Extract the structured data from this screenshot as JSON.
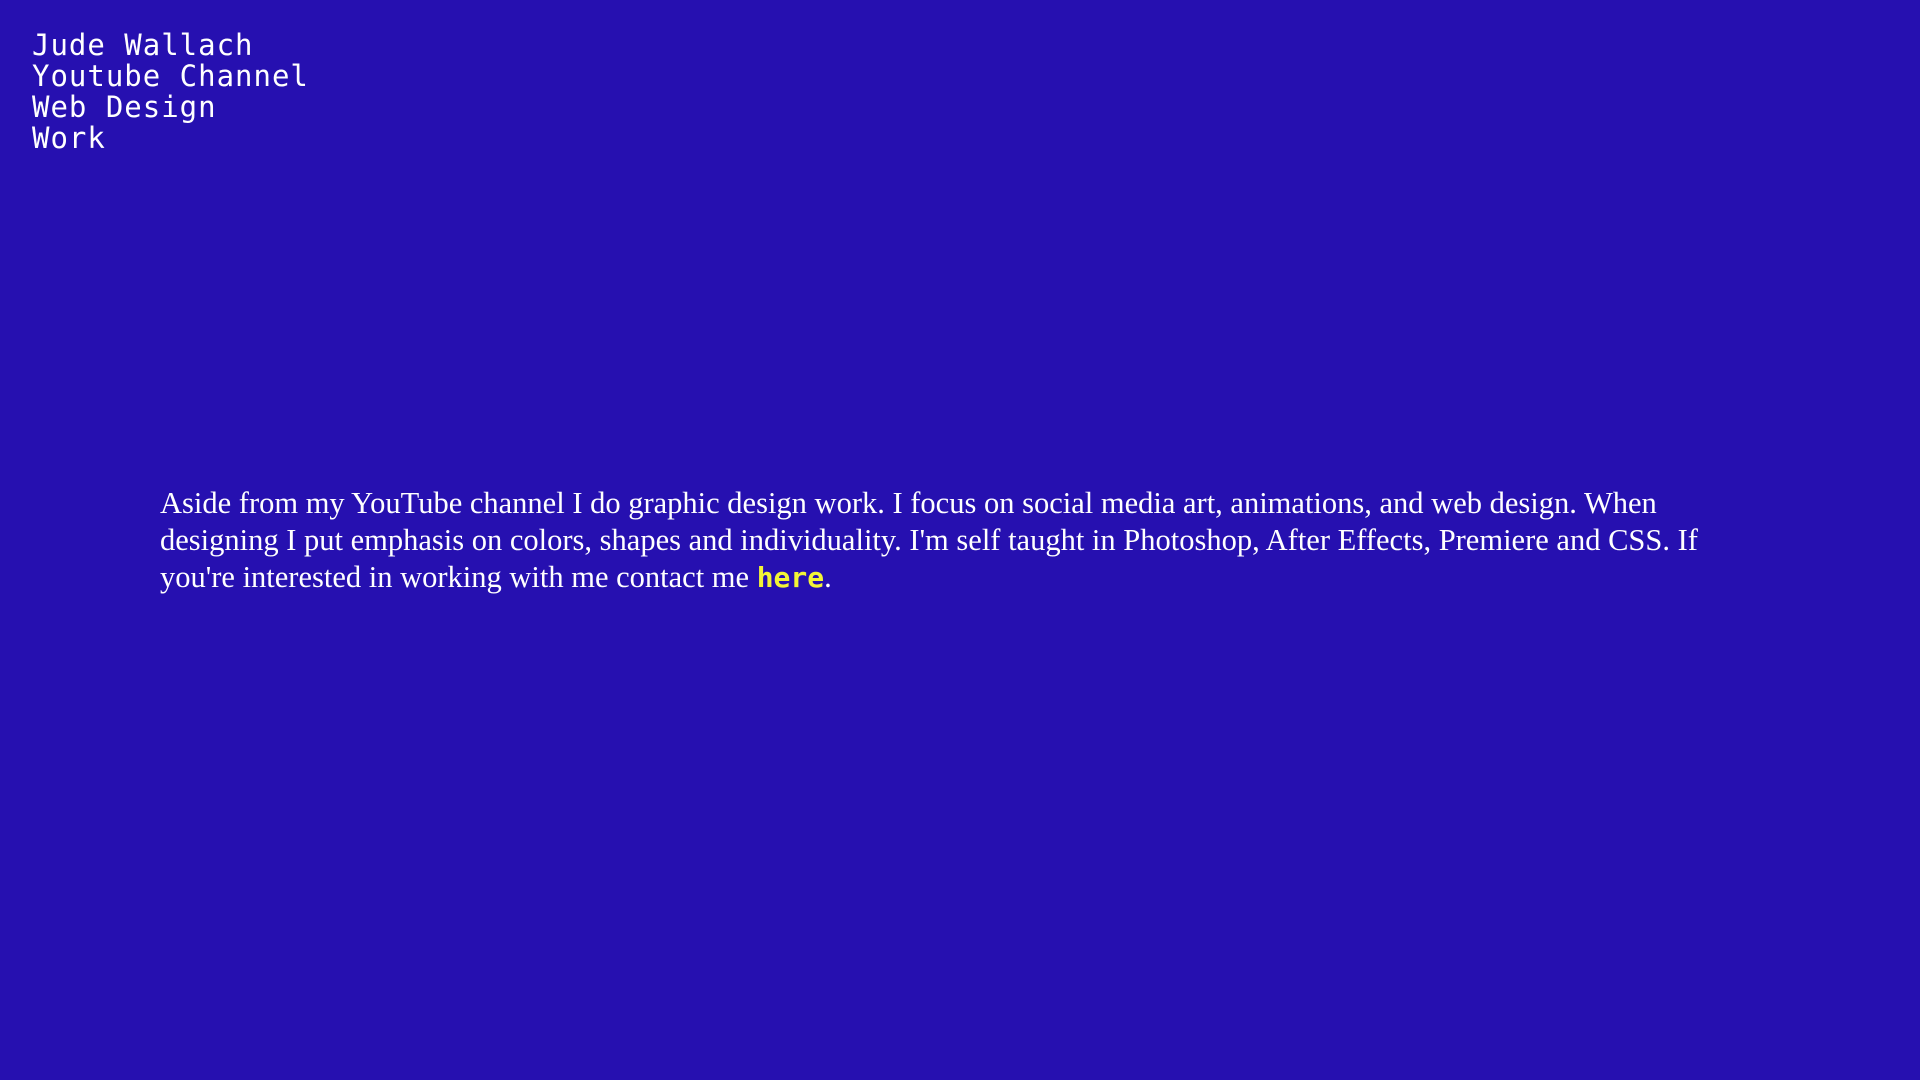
{
  "nav": {
    "items": [
      {
        "label": "Jude Wallach"
      },
      {
        "label": "Youtube Channel"
      },
      {
        "label": "Web Design"
      },
      {
        "label": "Work"
      }
    ]
  },
  "main": {
    "paragraph_text": "Aside from my YouTube channel I do graphic design work. I focus on social media art, animations, and web design. When designing I put emphasis on colors, shapes and individuality. I'm self taught in Photoshop, After Effects, Premiere and CSS. If you're interested in working with me contact me ",
    "link_label": "here",
    "trailing_text": "."
  },
  "colors": {
    "background": "#2610b0",
    "text": "#ffffff",
    "link": "#f3f536"
  }
}
